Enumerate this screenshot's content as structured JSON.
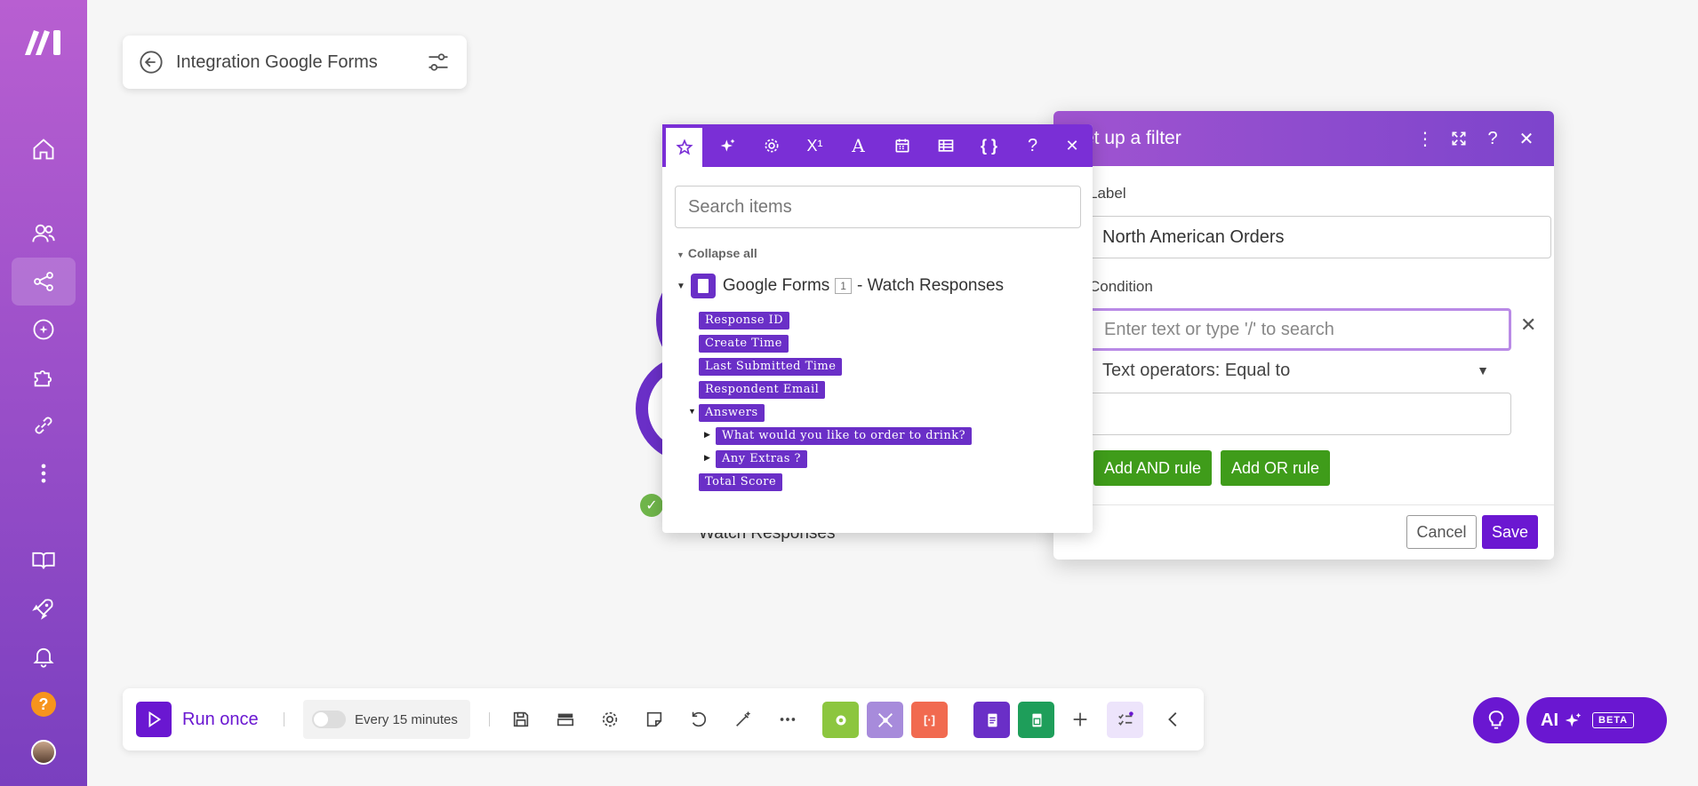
{
  "scenario": {
    "name": "Integration Google Forms"
  },
  "module": {
    "label": "Watch Responses"
  },
  "filter": {
    "title": "Set up a filter",
    "label_heading": "Label",
    "label_value": "North American Orders",
    "condition_heading": "Condition",
    "condition_placeholder": "Enter text or type '/' to search",
    "operator": "Text operators: Equal to",
    "add_and": "Add AND rule",
    "add_or": "Add OR rule",
    "cancel": "Cancel",
    "save": "Save"
  },
  "mapper": {
    "search_placeholder": "Search items",
    "collapse_all": "Collapse all",
    "source_name": "Google Forms",
    "source_badge": "1",
    "source_suffix": "- Watch Responses",
    "items": [
      "Response ID",
      "Create Time",
      "Last Submitted Time",
      "Respondent Email",
      "Answers",
      "What would you like to order to drink?",
      "Any Extras ?",
      "Total Score"
    ],
    "tabs": [
      "star-icon",
      "sparkle-icon",
      "gear-icon",
      "superscript-icon",
      "text-icon",
      "calendar-icon",
      "table-icon",
      "braces-icon",
      "help-icon",
      "close-icon"
    ]
  },
  "toolbar": {
    "run_once": "Run once",
    "schedule": "Every 15 minutes",
    "tile_colors": {
      "tools": "#8cc63f",
      "flow": "#a78bdb",
      "text": "#f16a50",
      "forms": "#6a2fc7",
      "sheets": "#1e9e5a"
    }
  },
  "ai": {
    "label": "AI",
    "beta": "BETA"
  },
  "colors": {
    "brand": "#6a17d1",
    "sidebar_top": "#b85fd1",
    "green": "#3f9c1a"
  }
}
